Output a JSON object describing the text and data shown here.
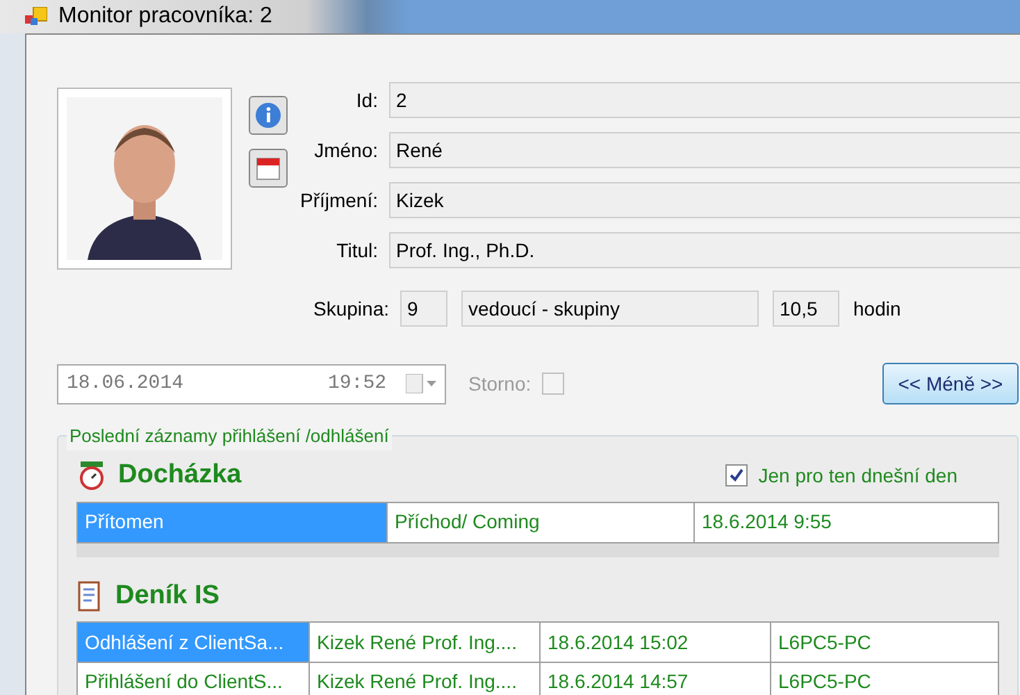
{
  "window": {
    "title": "Monitor pracovníka: 2"
  },
  "fields": [
    {
      "label": "Id:",
      "value": "2"
    },
    {
      "label": "Jméno:",
      "value": "René"
    },
    {
      "label": "Příjmení:",
      "value": "Kizek"
    },
    {
      "label": "Titul:",
      "value": "Prof. Ing., Ph.D."
    }
  ],
  "group": {
    "label": "Skupina:",
    "number": "9",
    "name": "vedoucí - skupiny",
    "hours": "10,5",
    "unit": "hodin"
  },
  "datetime": {
    "date": "18.06.2014",
    "time": "19:52"
  },
  "storno": {
    "label": "Storno:",
    "checked": false,
    "disabled": true
  },
  "less_button": "<< Méně >>",
  "log_section": {
    "title": "Poslední záznamy přihlášení /odhlášení",
    "today_only": {
      "label": "Jen pro ten dnešní den",
      "checked": true
    },
    "attendance": {
      "title": "Docházka",
      "rows": [
        {
          "cells": [
            "Přítomen",
            "Příchod/ Coming",
            "18.6.2014 9:55"
          ],
          "selected": true
        }
      ]
    },
    "journal": {
      "title": "Deník IS",
      "rows": [
        {
          "cells": [
            "Odhlášení z ClientSa...",
            "Kizek René Prof. Ing....",
            "18.6.2014 15:02",
            "L6PC5-PC"
          ],
          "selected": true
        },
        {
          "cells": [
            "Přihlášení do ClientS...",
            "Kizek René Prof. Ing....",
            "18.6.2014 14:57",
            "L6PC5-PC"
          ],
          "selected": false
        }
      ]
    }
  }
}
